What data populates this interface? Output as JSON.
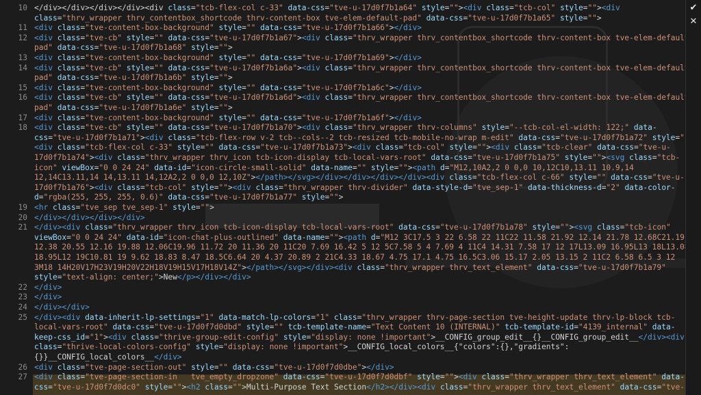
{
  "editor": {
    "lines": [
      {
        "n": "10",
        "html": "<span class='p'>&lt;/div&gt;&lt;/div&gt;&lt;/div&gt;&lt;/div&gt;&lt;div </span><span class='a'>class</span>=<span class='v'>\"tcb-flex-col c-33\"</span> <span class='a'>data-css</span>=<span class='v'>\"tve-u-17d0f7b1a64\"</span> <span class='a'>style</span>=<span class='v'>\"\"</span>&gt;<span class='t'>&lt;div</span> <span class='a'>class</span>=<span class='v'>\"tcb-col\"</span> <span class='a'>style</span>=<span class='v'>\"\"</span>&gt;<span class='t'>&lt;div</span>"
      },
      {
        "n": "",
        "html": "<span class='a'>class</span>=<span class='v'>\"thrv_wrapper thrv_contentbox_shortcode thrv-content-box tve-elem-default-pad\"</span> <span class='a'>data-css</span>=<span class='v'>\"tve-u-17d0f7b1a65\"</span> <span class='a'>style</span>=<span class='v'>\"\"</span>&gt;"
      },
      {
        "n": "11",
        "html": "<span class='t'>&lt;div</span> <span class='a'>class</span>=<span class='v'>\"tve-content-box-background\"</span> <span class='a'>style</span>=<span class='v'>\"\"</span> <span class='a'>data-css</span>=<span class='v'>\"tve-u-17d0f7b1a66\"</span>&gt;<span class='t'>&lt;/div&gt;</span>"
      },
      {
        "n": "12",
        "html": "<span class='t'>&lt;div</span> <span class='a'>class</span>=<span class='v'>\"tve-cb\"</span> <span class='a'>style</span>=<span class='v'>\"\"</span> <span class='a'>data-css</span>=<span class='v'>\"tve-u-17d0f7b1a67\"</span>&gt;<span class='t'>&lt;div</span> <span class='a'>class</span>=<span class='v'>\"thrv_wrapper thrv_contentbox_shortcode thrv-content-box tve-elem-default-</span>"
      },
      {
        "n": "",
        "html": "<span class='v'>pad\"</span> <span class='a'>data-css</span>=<span class='v'>\"tve-u-17d0f7b1a68\"</span> <span class='a'>style</span>=<span class='v'>\"\"</span>&gt;"
      },
      {
        "n": "13",
        "html": "<span class='t'>&lt;div</span> <span class='a'>class</span>=<span class='v'>\"tve-content-box-background\"</span> <span class='a'>style</span>=<span class='v'>\"\"</span> <span class='a'>data-css</span>=<span class='v'>\"tve-u-17d0f7b1a69\"</span>&gt;<span class='t'>&lt;/div&gt;</span>"
      },
      {
        "n": "14",
        "html": "<span class='t'>&lt;div</span> <span class='a'>class</span>=<span class='v'>\"tve-cb\"</span> <span class='a'>style</span>=<span class='v'>\"\"</span> <span class='a'>data-css</span>=<span class='v'>\"tve-u-17d0f7b1a6a\"</span>&gt;<span class='t'>&lt;div</span> <span class='a'>class</span>=<span class='v'>\"thrv_wrapper thrv_contentbox_shortcode thrv-content-box tve-elem-default-</span>"
      },
      {
        "n": "",
        "html": "<span class='v'>pad\"</span> <span class='a'>data-css</span>=<span class='v'>\"tve-u-17d0f7b1a6b\"</span> <span class='a'>style</span>=<span class='v'>\"\"</span>&gt;"
      },
      {
        "n": "15",
        "html": "<span class='t'>&lt;div</span> <span class='a'>class</span>=<span class='v'>\"tve-content-box-background\"</span> <span class='a'>style</span>=<span class='v'>\"\"</span> <span class='a'>data-css</span>=<span class='v'>\"tve-u-17d0f7b1a6c\"</span>&gt;<span class='t'>&lt;/div&gt;</span>"
      },
      {
        "n": "16",
        "html": "<span class='t'>&lt;div</span> <span class='a'>class</span>=<span class='v'>\"tve-cb\"</span> <span class='a'>style</span>=<span class='v'>\"\"</span> <span class='a'>data-css</span>=<span class='v'>\"tve-u-17d0f7b1a6d\"</span>&gt;<span class='t'>&lt;div</span> <span class='a'>class</span>=<span class='v'>\"thrv_wrapper thrv_contentbox_shortcode thrv-content-box tve-elem-default-</span>"
      },
      {
        "n": "",
        "html": "<span class='v'>pad\"</span> <span class='a'>data-css</span>=<span class='v'>\"tve-u-17d0f7b1a6e\"</span> <span class='a'>style</span>=<span class='v'>\"\"</span>&gt;"
      },
      {
        "n": "17",
        "html": "<span class='t'>&lt;div</span> <span class='a'>class</span>=<span class='v'>\"tve-content-box-background\"</span> <span class='a'>style</span>=<span class='v'>\"\"</span> <span class='a'>data-css</span>=<span class='v'>\"tve-u-17d0f7b1a6f\"</span>&gt;<span class='t'>&lt;/div&gt;</span>"
      },
      {
        "n": "18",
        "html": "<span class='t'>&lt;div</span> <span class='a'>class</span>=<span class='v'>\"tve-cb\"</span> <span class='a'>style</span>=<span class='v'>\"\"</span> <span class='a'>data-css</span>=<span class='v'>\"tve-u-17d0f7b1a70\"</span>&gt;<span class='t'>&lt;div</span> <span class='a'>class</span>=<span class='v'>\"thrv_wrapper thrv-columns\"</span> <span class='a'>style</span>=<span class='v'>\"--tcb-col-el-width: 122;\"</span> <span class='a'>data-</span>"
      },
      {
        "n": "",
        "html": "<span class='a'>css</span>=<span class='v'>\"tve-u-17d0f7b1a71\"</span>&gt;<span class='t'>&lt;div</span> <span class='a'>class</span>=<span class='v'>\"tcb-flex-row v-2 tcb--cols--2 tcb-resized tcb-mobile-no-wrap m-edit\"</span> <span class='a'>data-css</span>=<span class='v'>\"tve-u-17d0f7b1a72\"</span> <span class='a'>style</span>=<span class='v'>\"\"</span>&gt;"
      },
      {
        "n": "",
        "html": "<span class='t'>&lt;div</span> <span class='a'>class</span>=<span class='v'>\"tcb-flex-col c-33\"</span> <span class='a'>style</span>=<span class='v'>\"\"</span> <span class='a'>data-css</span>=<span class='v'>\"tve-u-17d0f7b1a73\"</span>&gt;<span class='t'>&lt;div</span> <span class='a'>class</span>=<span class='v'>\"tcb-col\"</span> <span class='a'>style</span>=<span class='v'>\"\"</span>&gt;<span class='t'>&lt;div</span> <span class='a'>class</span>=<span class='v'>\"tcb-clear\"</span> <span class='a'>data-css</span>=<span class='v'>\"tve-u-</span>"
      },
      {
        "n": "",
        "html": "<span class='v'>17d0f7b1a74\"</span>&gt;<span class='t'>&lt;div</span> <span class='a'>class</span>=<span class='v'>\"thrv_wrapper thrv_icon tcb-icon-display tcb-local-vars-root\"</span> <span class='a'>data-css</span>=<span class='v'>\"tve-u-17d0f7b1a75\"</span> <span class='a'>style</span>=<span class='v'>\"\"</span>&gt;<span class='t'>&lt;svg</span> <span class='a'>class</span>=<span class='v'>\"tcb-</span>"
      },
      {
        "n": "",
        "html": "<span class='v'>icon\"</span> <span class='a'>viewBox</span>=<span class='v'>\"0 0 24 24\"</span> <span class='a'>data-id</span>=<span class='v'>\"icon-circle-small-solid\"</span> <span class='a'>data-name</span>=<span class='v'>\"\"</span> <span class='a'>style</span>=<span class='v'>\"\"</span>&gt;<span class='t'>&lt;path</span> <span class='a'>d</span>=<span class='v'>\"M12,10A2,2 0 0,0 10,12C10,13.11 10.9,14</span>"
      },
      {
        "n": "",
        "html": "<span class='v'>12,14C13.11,14 14,13.11 14,12A2,2 0 0,0 12,10Z\"</span>&gt;<span class='t'>&lt;/path&gt;&lt;/svg&gt;&lt;/div&gt;&lt;/div&gt;&lt;/div&gt;&lt;/div&gt;&lt;div</span> <span class='a'>class</span>=<span class='v'>\"tcb-flex-col c-66\"</span> <span class='a'>style</span>=<span class='v'>\"\"</span> <span class='a'>data-css</span>=<span class='v'>\"tve-u-</span>"
      },
      {
        "n": "",
        "html": "<span class='v'>17d0f7b1a76\"</span>&gt;<span class='t'>&lt;div</span> <span class='a'>class</span>=<span class='v'>\"tcb-col\"</span> <span class='a'>style</span>=<span class='v'>\"\"</span>&gt;<span class='t'>&lt;div</span> <span class='a'>class</span>=<span class='v'>\"thrv_wrapper thrv-divider\"</span> <span class='a'>data-style-d</span>=<span class='v'>\"tve_sep-1\"</span> <span class='a'>data-thickness-d</span>=<span class='v'>\"2\"</span> <span class='a'>data-color-</span>"
      },
      {
        "n": "",
        "html": "<span class='a'>d</span>=<span class='v'>\"rgba(255, 255, 255, 0.6)\"</span> <span class='a'>data-css</span>=<span class='v'>\"tve-u-17d0f7b1a77\"</span> <span class='a'>style</span>=<span class='v'>\"\"</span>&gt;"
      },
      {
        "n": "19",
        "html": "<span class='t'>&lt;hr</span> <span class='a'>class</span>=<span class='v'>\"tve_sep tve_sep-1\"</span> <span class='a'>style</span>=<span class='v'>\"\"</span>&gt;"
      },
      {
        "n": "20",
        "html": "<span class='t'>&lt;/div&gt;&lt;/div&gt;&lt;/div&gt;&lt;/div&gt;</span>"
      },
      {
        "n": "21",
        "html": "<span class='t'>&lt;/div&gt;&lt;div</span> <span class='a'>class</span>=<span class='v'>\"thrv_wrapper thrv_icon tcb-icon-display tcb-local-vars-root\"</span> <span class='a'>data-css</span>=<span class='v'>\"tve-u-17d0f7b1a78\"</span> <span class='a'>style</span>=<span class='v'>\"\"</span>&gt;<span class='t'>&lt;svg</span> <span class='a'>class</span>=<span class='v'>\"tcb-icon\"</span>"
      },
      {
        "n": "",
        "html": "<span class='a'>viewBox</span>=<span class='v'>\"0 0 24 24\"</span> <span class='a'>data-id</span>=<span class='v'>\"icon-chat-plus-outlined\"</span> <span class='a'>data-name</span>=<span class='v'>\"\"</span>&gt;<span class='t'>&lt;path</span> <span class='a'>d</span>=<span class='v'>\"M12 3C17.5 3 22 6.58 22 11C22 11.58 21.92 12.14 21.78 12.68C21.19</span>"
      },
      {
        "n": "",
        "html": "<span class='v'>12.38 20.55 12.16 19.88 12.06C19.96 11.72 20 11.36 20 11C20 7.69 16.42 5 12 5C7.58 5 4 7.69 4 11C4 14.31 7.58 17 12 17L13.09 16.95L13 18L13.08</span>"
      },
      {
        "n": "",
        "html": "<span class='v'>18.95L12 19C10.81 19 9.62 18.83 8.47 18.5C6.64 20 4.37 20.89 2 21C4.33 18.67 4.75 17.1 4.75 16.5C3.06 15.17 2.05 13.15 2 11C2 6.58 6.5 3 12</span>"
      },
      {
        "n": "",
        "html": "<span class='v'>3M18 14H20V17H23V19H20V22H18V19H15V17H18V14Z\"</span>&gt;<span class='t'>&lt;/path&gt;&lt;/svg&gt;&lt;/div&gt;&lt;div</span> <span class='a'>class</span>=<span class='v'>\"thrv_wrapper thrv_text_element\"</span> <span class='a'>data-css</span>=<span class='v'>\"tve-u-17d0f7b1a79\"</span>"
      },
      {
        "n": "",
        "html": "<span class='a'>style</span>=<span class='v'>\"text-align: center;\"</span>&gt;<span class='p'>New</span><span class='t'>&lt;/p&gt;&lt;/div&gt;&lt;/div&gt;</span>"
      },
      {
        "n": "22",
        "html": "<span class='t'>&lt;/div&gt;</span>"
      },
      {
        "n": "23",
        "html": "<span class='t'>&lt;/div&gt;</span>"
      },
      {
        "n": "24",
        "html": "<span class='t'>&lt;/div&gt;&lt;/div&gt;</span>"
      },
      {
        "n": "25",
        "html": "<span class='t'>&lt;/div&gt;&lt;div</span> <span class='a'>data-inherit-lp-settings</span>=<span class='v'>\"1\"</span> <span class='a'>data-match-lp-colors</span>=<span class='v'>\"1\"</span> <span class='a'>class</span>=<span class='v'>\"thrv_wrapper thrv-page-section tve-height-update thrv-lp-block tcb-</span>"
      },
      {
        "n": "",
        "html": "<span class='v'>local-vars-root\"</span> <span class='a'>data-css</span>=<span class='v'>\"tve-u-17d0f7d0dbd\"</span> <span class='a'>style</span>=<span class='v'>\"\"</span> <span class='a'>tcb-template-name</span>=<span class='v'>\"Text Content 10 (INTERNAL)\"</span> <span class='a'>tcb-template-id</span>=<span class='v'>\"4139_internal\"</span> <span class='a'>data-</span>"
      },
      {
        "n": "",
        "html": "<span class='a'>keep-css_id</span>=<span class='v'>\"1\"</span>&gt;<span class='t'>&lt;div</span> <span class='a'>class</span>=<span class='v'>\"thrive-group-edit-config\"</span> <span class='a'>style</span>=<span class='v'>\"display: none !important\"</span>&gt;<span class='p'>__CONFIG_group_edit__{}__CONFIG_group_edit__</span><span class='t'>&lt;/div&gt;&lt;div</span>"
      },
      {
        "n": "",
        "html": "<span class='a'>class</span>=<span class='v'>\"thrive-local-colors-config\"</span> <span class='a'>style</span>=<span class='v'>\"display: none !important\"</span>&gt;<span class='p'>__CONFIG_local_colors__{\"colors\":{},\"gradients\":</span>"
      },
      {
        "n": "",
        "html": "<span class='p'>{}}__CONFIG_local_colors__</span><span class='t'>&lt;/div&gt;</span>"
      },
      {
        "n": "26",
        "html": "<span class='t'>&lt;div</span> <span class='a'>class</span>=<span class='v'>\"tve-page-section-out\"</span> <span class='a'>style</span>=<span class='v'>\"\"</span> <span class='a'>data-css</span>=<span class='v'>\"tve-u-17d0f7d0dbe\"</span>&gt;<span class='t'>&lt;/div&gt;</span>"
      },
      {
        "n": "27",
        "html": "<span class='t'>&lt;div</span> <span class='a'>class</span>=<span class='v'>\"tve-page-section-in   tve_empty_dropzone\"</span> <span class='a'>data-css</span>=<span class='v'>\"tve-u-17d0f7d0dbf\"</span> <span class='a'>style</span>=<span class='v'>\"\"</span>&gt;<span class='t'>&lt;div</span> <span class='a'>class</span>=<span class='v'>\"thrv_wrapper thrv_text_element\"</span> <span class='a'>data-</span>"
      },
      {
        "n": "",
        "html": "<span class='a'>css</span>=<span class='v'>\"tve-u-17d0f7d0dc0\"</span> <span class='a'>style</span>=<span class='v'>\"\"</span>&gt;<span class='t'>&lt;h2</span> <span class='a'>class</span>=<span class='v'>\"\"</span>&gt;<span class='p'>Multi-Purpose Text Section</span><span class='t'>&lt;/h2&gt;&lt;/div&gt;&lt;div</span> <span class='a'>class</span>=<span class='v'>\"thrv_wrapper thrv_text_element\"</span> <span class='a'>data-css</span>=<span class='v'>\"tve-u</span>"
      }
    ]
  },
  "side_toolbar": {
    "confirm_icon": "✔",
    "close_icon": "✕"
  },
  "colors": {
    "background": "#1c1c1c",
    "tag": "#569cd6",
    "attribute": "#9cdcfe",
    "value": "#ce9178",
    "highlight": "#ffc440"
  }
}
